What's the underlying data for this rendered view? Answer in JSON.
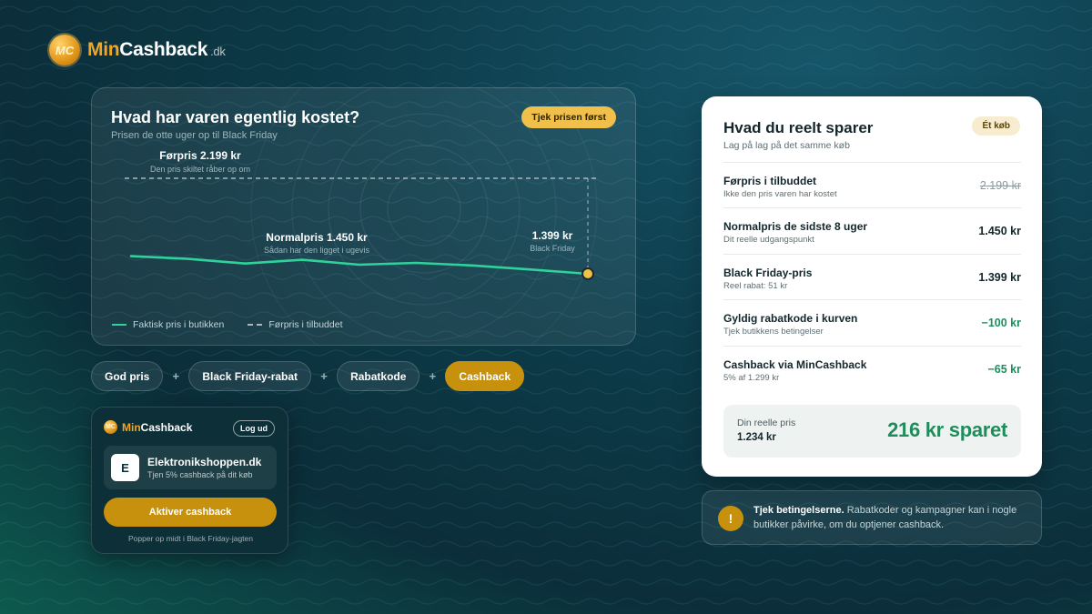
{
  "brand": {
    "mark": "MC",
    "part1": "Min",
    "part2": "Cashback",
    "tld": ".dk"
  },
  "chart_card": {
    "title": "Hvad har varen egentlig kostet?",
    "subtitle": "Prisen de otte uger op til Black Friday",
    "button": "Tjek prisen først",
    "legend_actual": "Faktisk pris i butikken",
    "legend_before": "Førpris i tilbuddet"
  },
  "chart_data": {
    "type": "line",
    "series": [
      {
        "name": "Faktisk pris i butikken",
        "values": [
          1478,
          1466,
          1445,
          1462,
          1440,
          1448,
          1436,
          1418,
          1399
        ]
      },
      {
        "name": "Førpris i tilbuddet",
        "values": [
          2199,
          2199,
          2199,
          2199,
          2199,
          2199,
          2199,
          2199,
          2199
        ]
      }
    ],
    "annotations": {
      "before_label": "Førpris 2.199 kr",
      "before_note": "Den pris skiltet råber op om",
      "normal_label": "Normalpris 1.450 kr",
      "normal_note": "Sådan har den ligget i ugevis",
      "bf_label": "1.399 kr",
      "bf_note": "Black Friday"
    },
    "colors": {
      "actual": "#2ed39b",
      "before": "#a9b8bb",
      "marker": "#f1c04a"
    }
  },
  "pills": {
    "p1": "God pris",
    "p2": "Black Friday-rabat",
    "p3": "Rabatkode",
    "p4": "Cashback",
    "plus": "+"
  },
  "popup": {
    "logo_mark": "MC",
    "logo_part1": "Min",
    "logo_part2": "Cashback",
    "logout": "Log ud",
    "shop_letter": "E",
    "shop_name": "Elektronikshoppen.dk",
    "shop_sub": "Tjen 5% cashback på dit køb",
    "activate": "Aktiver cashback",
    "footer": "Popper op midt i Black Friday-jagten"
  },
  "savings": {
    "title": "Hvad du reelt sparer",
    "subtitle": "Lag på lag på det samme køb",
    "chip": "Ét køb",
    "rows": [
      {
        "label": "Førpris i tilbuddet",
        "note": "Ikke den pris varen har kostet",
        "value": "2.199 kr"
      },
      {
        "label": "Normalpris de sidste 8 uger",
        "note": "Dit reelle udgangspunkt",
        "value": "1.450 kr"
      },
      {
        "label": "Black Friday-pris",
        "note": "Reel rabat: 51 kr",
        "value": "1.399 kr"
      },
      {
        "label": "Gyldig rabatkode i kurven",
        "note": "Tjek butikkens betingelser",
        "value": "−100 kr"
      },
      {
        "label": "Cashback via MinCashback",
        "note": "5% af 1.299 kr",
        "value": "−65 kr"
      }
    ],
    "total_label": "Din reelle pris",
    "total_value": "1.234 kr",
    "total_saved": "216 kr sparet"
  },
  "notice": {
    "icon": "!",
    "bold": "Tjek betingelserne.",
    "text": " Rabatkoder og kampagner kan i nogle butikker påvirke, om du optjener cashback."
  }
}
